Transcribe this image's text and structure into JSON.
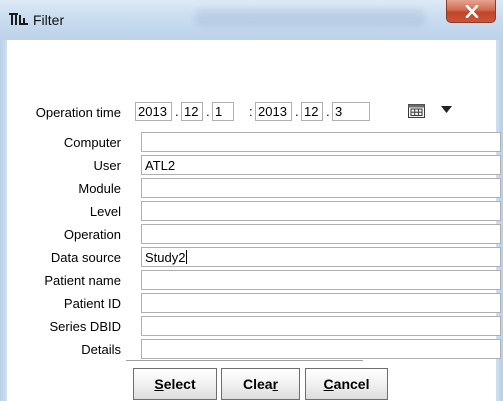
{
  "window": {
    "title": "Filter",
    "icon": "pmod-logo-icon",
    "close_icon": "close-icon"
  },
  "operation_time": {
    "label": "Operation time",
    "from": {
      "year": "2013",
      "month": "12",
      "day": "1"
    },
    "to": {
      "year": "2013",
      "month": "12",
      "day": "3"
    },
    "date_separator": ".",
    "range_separator": ":",
    "calendar_icon": "calendar-icon",
    "dropdown_icon": "triangle-down-icon"
  },
  "fields": [
    {
      "label": "Computer",
      "value": ""
    },
    {
      "label": "User",
      "value": "ATL2"
    },
    {
      "label": "Module",
      "value": ""
    },
    {
      "label": "Level",
      "value": ""
    },
    {
      "label": "Operation",
      "value": ""
    },
    {
      "label": "Data source",
      "value": "Study2"
    },
    {
      "label": "Patient name",
      "value": ""
    },
    {
      "label": "Patient ID",
      "value": ""
    },
    {
      "label": "Series DBID",
      "value": ""
    },
    {
      "label": "Details",
      "value": ""
    }
  ],
  "buttons": {
    "select": {
      "label_mnemonic": "S",
      "label_rest": "elect"
    },
    "clear": {
      "label_start": "Clea",
      "label_mnemonic": "r",
      "label_rest": ""
    },
    "cancel": {
      "label_mnemonic": "C",
      "label_rest": "ancel"
    }
  },
  "colors": {
    "titlebar": "#c9dcf0",
    "close_button": "#c9573a",
    "field_border": "#b0b0b0"
  }
}
